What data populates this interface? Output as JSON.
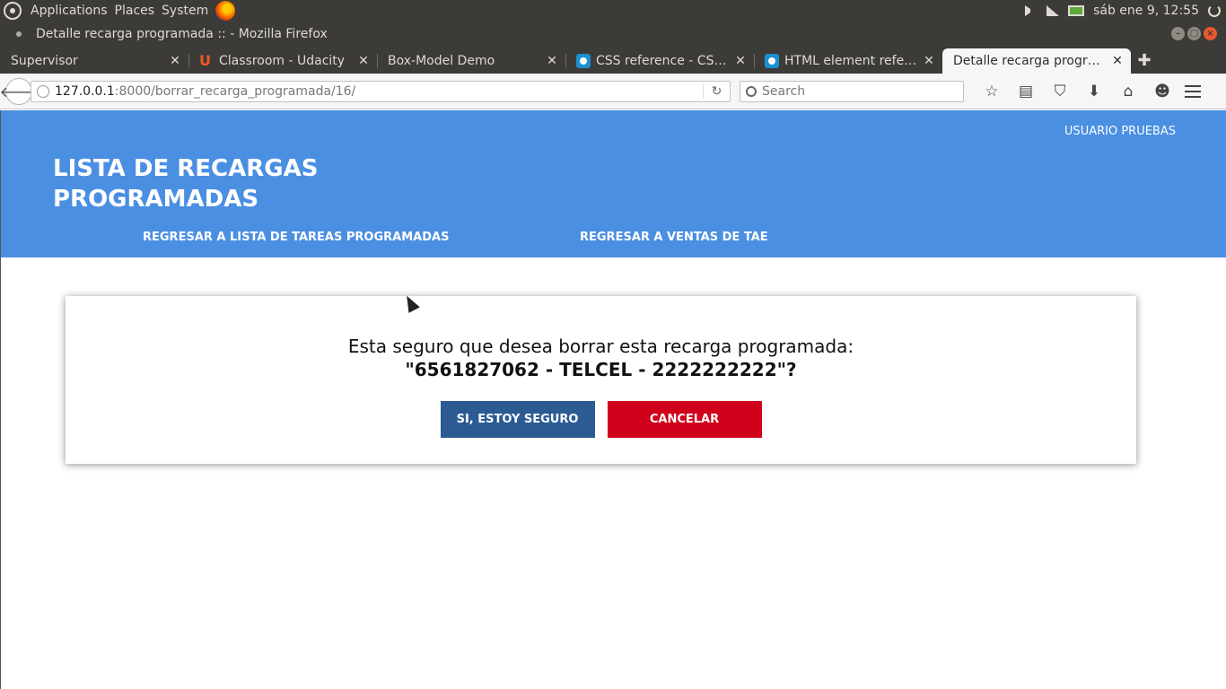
{
  "system_panel": {
    "menus": [
      "Applications",
      "Places",
      "System"
    ],
    "clock": "sáb ene  9, 12:55"
  },
  "window": {
    "title": "Detalle recarga programada :: - Mozilla Firefox"
  },
  "tabs": [
    {
      "label": "Supervisor",
      "favicon": "none"
    },
    {
      "label": "Classroom - Udacity",
      "favicon": "udacity-icon"
    },
    {
      "label": "Box-Model Demo",
      "favicon": "none"
    },
    {
      "label": "CSS reference - CSS |...",
      "favicon": "mdn-icon"
    },
    {
      "label": "HTML element refer...",
      "favicon": "mdn-icon"
    },
    {
      "label": "Detalle recarga progra...",
      "favicon": "none",
      "active": true
    }
  ],
  "navbar": {
    "url_host": "127.0.0.1",
    "url_path": ":8000/borrar_recarga_programada/16/",
    "search_placeholder": "Search"
  },
  "page": {
    "user": "USUARIO PRUEBAS",
    "title": "LISTA DE RECARGAS PROGRAMADAS",
    "nav": {
      "tasks": "REGRESAR A LISTA DE TAREAS PROGRAMADAS",
      "sales": "REGRESAR A VENTAS DE TAE"
    },
    "dialog": {
      "question": "Esta seguro que desea borrar esta recarga programada:",
      "record": "\"6561827062 - TELCEL - 2222222222\"?",
      "confirm": "SI, ESTOY SEGURO",
      "cancel": "CANCELAR"
    }
  },
  "colors": {
    "header": "#4a8fe2",
    "confirm_button": "#2c5b94",
    "cancel_button": "#d0021b"
  }
}
